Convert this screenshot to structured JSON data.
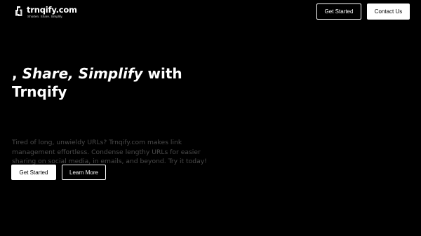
{
  "brand": {
    "name": "trnqify.com",
    "tagline": "Shorten. Share. Simplify.",
    "icon": "link-chain-icon"
  },
  "nav": {
    "get_started": "Get Started",
    "contact_us": "Contact Us"
  },
  "hero": {
    "title_prefix": ", ",
    "title_emphasis": "Share, Simplify",
    "title_suffix": " with Trnqify",
    "description": "Tired of long, unwieldy URLs? Trnqify.com makes link management effortless. Condense lengthy URLs for easier sharing on social media, in emails, and beyond. Try it today!",
    "primary_button": "Get Started",
    "secondary_button": "Learn More"
  },
  "colors": {
    "background": "#000000",
    "text": "#ffffff",
    "muted_text": "#4a4a4a",
    "button_solid_bg": "#ffffff",
    "button_solid_text": "#000000"
  }
}
